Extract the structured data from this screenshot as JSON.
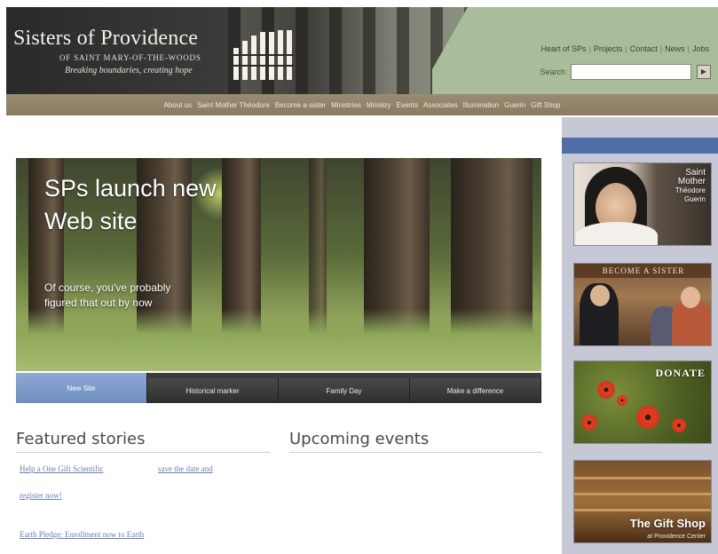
{
  "header": {
    "brand_name": "Sisters of Providence",
    "brand_sub": "OF SAINT MARY-OF-THE-WOODS",
    "tagline": "Breaking boundaries, creating hope",
    "top_links": [
      "Heart of SPs",
      "Projects",
      "Contact",
      "News",
      "Jobs"
    ],
    "search_label": "Search",
    "search_value": "",
    "search_button": "Go"
  },
  "nav": {
    "items": [
      "About us",
      "Saint Mother Théodore",
      "Become a sister",
      "Ministries",
      "Ministry",
      "Events",
      "Associates",
      "Illumination",
      "Guerin",
      "Gift Shop"
    ]
  },
  "hero": {
    "title": "SPs launch new Web site",
    "subtitle": "Of course, you've probably figured that out by now",
    "tabs": [
      "New Site",
      "Historical marker",
      "Family Day",
      "Make a difference"
    ]
  },
  "featured": {
    "heading": "Featured stories",
    "stories": [
      "Help a One Gift Scientific",
      "save the date and",
      "register now!",
      "Earth Pledge: Enrollment now to Earth"
    ]
  },
  "events": {
    "heading": "Upcoming events"
  },
  "sidebar": {
    "saint": {
      "line1": "Saint",
      "line2": "Mother",
      "line3": "Théodore",
      "line4": "Guerin"
    },
    "sister_banner": "BECOME A SISTER",
    "donate_label": "DONATE",
    "gift_title": "The Gift Shop",
    "gift_sub": "at Providence Center"
  },
  "colors": {
    "nav_bar": "#8a7a62",
    "header_green": "#a9bd9a",
    "sidebar_bg": "#c7c8d6",
    "sidebar_strip": "#4f6ea8",
    "active_tab": "#7f9acb",
    "link": "#6a7fb0"
  }
}
